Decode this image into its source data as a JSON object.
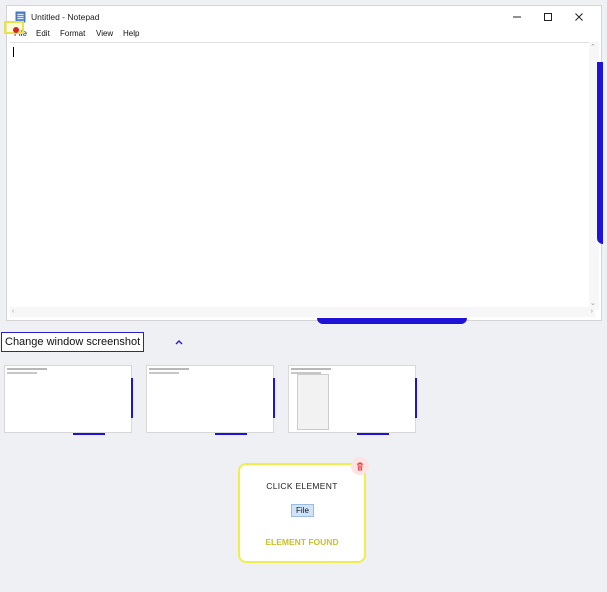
{
  "notepad": {
    "title": "Untitled - Notepad",
    "menu": [
      "File",
      "Edit",
      "Format",
      "View",
      "Help"
    ],
    "content": ""
  },
  "panel": {
    "change_window_label": "Change window screenshot"
  },
  "card": {
    "action": "CLICK ELEMENT",
    "element": "File",
    "status": "ELEMENT FOUND"
  },
  "colors": {
    "accent_blue": "#1d12d6",
    "highlight_yellow": "#f0ee4c",
    "status_yellow": "#c9c12a",
    "delete_red": "#e53a3a"
  }
}
